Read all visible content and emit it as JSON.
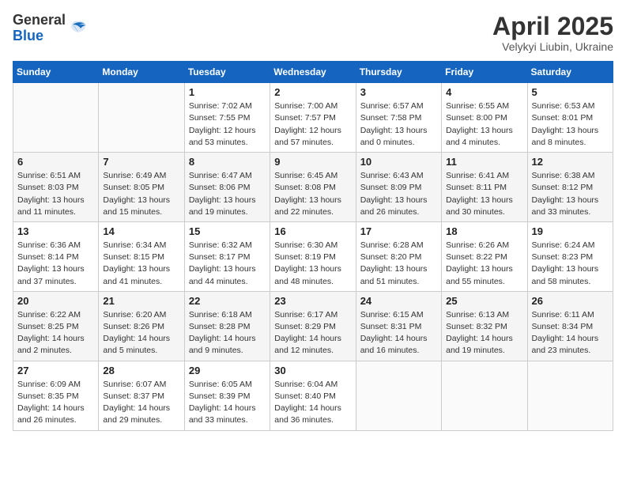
{
  "header": {
    "logo_general": "General",
    "logo_blue": "Blue",
    "month": "April 2025",
    "location": "Velykyi Liubin, Ukraine"
  },
  "weekdays": [
    "Sunday",
    "Monday",
    "Tuesday",
    "Wednesday",
    "Thursday",
    "Friday",
    "Saturday"
  ],
  "weeks": [
    [
      {
        "num": "",
        "info": ""
      },
      {
        "num": "",
        "info": ""
      },
      {
        "num": "1",
        "info": "Sunrise: 7:02 AM\nSunset: 7:55 PM\nDaylight: 12 hours\nand 53 minutes."
      },
      {
        "num": "2",
        "info": "Sunrise: 7:00 AM\nSunset: 7:57 PM\nDaylight: 12 hours\nand 57 minutes."
      },
      {
        "num": "3",
        "info": "Sunrise: 6:57 AM\nSunset: 7:58 PM\nDaylight: 13 hours\nand 0 minutes."
      },
      {
        "num": "4",
        "info": "Sunrise: 6:55 AM\nSunset: 8:00 PM\nDaylight: 13 hours\nand 4 minutes."
      },
      {
        "num": "5",
        "info": "Sunrise: 6:53 AM\nSunset: 8:01 PM\nDaylight: 13 hours\nand 8 minutes."
      }
    ],
    [
      {
        "num": "6",
        "info": "Sunrise: 6:51 AM\nSunset: 8:03 PM\nDaylight: 13 hours\nand 11 minutes."
      },
      {
        "num": "7",
        "info": "Sunrise: 6:49 AM\nSunset: 8:05 PM\nDaylight: 13 hours\nand 15 minutes."
      },
      {
        "num": "8",
        "info": "Sunrise: 6:47 AM\nSunset: 8:06 PM\nDaylight: 13 hours\nand 19 minutes."
      },
      {
        "num": "9",
        "info": "Sunrise: 6:45 AM\nSunset: 8:08 PM\nDaylight: 13 hours\nand 22 minutes."
      },
      {
        "num": "10",
        "info": "Sunrise: 6:43 AM\nSunset: 8:09 PM\nDaylight: 13 hours\nand 26 minutes."
      },
      {
        "num": "11",
        "info": "Sunrise: 6:41 AM\nSunset: 8:11 PM\nDaylight: 13 hours\nand 30 minutes."
      },
      {
        "num": "12",
        "info": "Sunrise: 6:38 AM\nSunset: 8:12 PM\nDaylight: 13 hours\nand 33 minutes."
      }
    ],
    [
      {
        "num": "13",
        "info": "Sunrise: 6:36 AM\nSunset: 8:14 PM\nDaylight: 13 hours\nand 37 minutes."
      },
      {
        "num": "14",
        "info": "Sunrise: 6:34 AM\nSunset: 8:15 PM\nDaylight: 13 hours\nand 41 minutes."
      },
      {
        "num": "15",
        "info": "Sunrise: 6:32 AM\nSunset: 8:17 PM\nDaylight: 13 hours\nand 44 minutes."
      },
      {
        "num": "16",
        "info": "Sunrise: 6:30 AM\nSunset: 8:19 PM\nDaylight: 13 hours\nand 48 minutes."
      },
      {
        "num": "17",
        "info": "Sunrise: 6:28 AM\nSunset: 8:20 PM\nDaylight: 13 hours\nand 51 minutes."
      },
      {
        "num": "18",
        "info": "Sunrise: 6:26 AM\nSunset: 8:22 PM\nDaylight: 13 hours\nand 55 minutes."
      },
      {
        "num": "19",
        "info": "Sunrise: 6:24 AM\nSunset: 8:23 PM\nDaylight: 13 hours\nand 58 minutes."
      }
    ],
    [
      {
        "num": "20",
        "info": "Sunrise: 6:22 AM\nSunset: 8:25 PM\nDaylight: 14 hours\nand 2 minutes."
      },
      {
        "num": "21",
        "info": "Sunrise: 6:20 AM\nSunset: 8:26 PM\nDaylight: 14 hours\nand 5 minutes."
      },
      {
        "num": "22",
        "info": "Sunrise: 6:18 AM\nSunset: 8:28 PM\nDaylight: 14 hours\nand 9 minutes."
      },
      {
        "num": "23",
        "info": "Sunrise: 6:17 AM\nSunset: 8:29 PM\nDaylight: 14 hours\nand 12 minutes."
      },
      {
        "num": "24",
        "info": "Sunrise: 6:15 AM\nSunset: 8:31 PM\nDaylight: 14 hours\nand 16 minutes."
      },
      {
        "num": "25",
        "info": "Sunrise: 6:13 AM\nSunset: 8:32 PM\nDaylight: 14 hours\nand 19 minutes."
      },
      {
        "num": "26",
        "info": "Sunrise: 6:11 AM\nSunset: 8:34 PM\nDaylight: 14 hours\nand 23 minutes."
      }
    ],
    [
      {
        "num": "27",
        "info": "Sunrise: 6:09 AM\nSunset: 8:35 PM\nDaylight: 14 hours\nand 26 minutes."
      },
      {
        "num": "28",
        "info": "Sunrise: 6:07 AM\nSunset: 8:37 PM\nDaylight: 14 hours\nand 29 minutes."
      },
      {
        "num": "29",
        "info": "Sunrise: 6:05 AM\nSunset: 8:39 PM\nDaylight: 14 hours\nand 33 minutes."
      },
      {
        "num": "30",
        "info": "Sunrise: 6:04 AM\nSunset: 8:40 PM\nDaylight: 14 hours\nand 36 minutes."
      },
      {
        "num": "",
        "info": ""
      },
      {
        "num": "",
        "info": ""
      },
      {
        "num": "",
        "info": ""
      }
    ]
  ]
}
